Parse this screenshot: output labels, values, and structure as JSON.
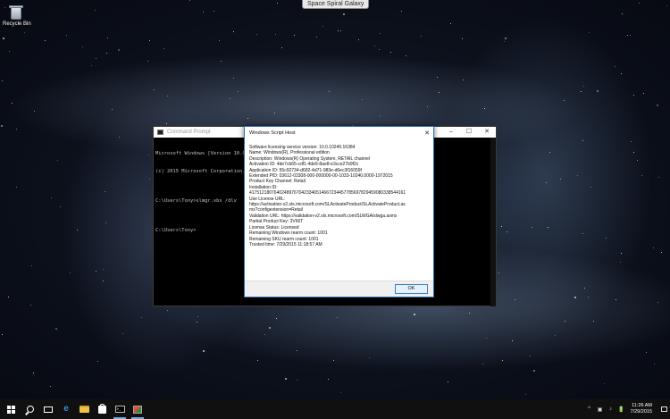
{
  "desktop": {
    "tooltip": "Space Spiral Galaxy",
    "recycle_bin_label": "Recycle Bin"
  },
  "cmd_window": {
    "title": "Command Prompt",
    "lines": [
      "Microsoft Windows [Version 10.0.",
      "(c) 2015 Microsoft Corporation.",
      "",
      "C:\\Users\\Tony>slmgr.vbs /dlv",
      "",
      "C:\\Users\\Tony>"
    ],
    "controls": {
      "minimize": "–",
      "maximize": "☐",
      "close": "✕"
    }
  },
  "wsh_dialog": {
    "title": "Windows Script Host",
    "close": "✕",
    "lines": [
      "Software licensing service version: 10.0.10240.16384",
      "",
      "Name: Windows(R), Professional edition",
      "Description: Windows(R) Operating System, RETAIL channel",
      "Activation ID: 4de7cb65-cdf1-4de9-8ae8-e3cce27b9f2c",
      "Application ID: 55c92734-d682-4d71-983e-d6ec3f16059f",
      "Extended PID: 03612-03308-000-000000-00-1033-10240.0000-1972015",
      "Product Key Channel: Retail",
      "Installation ID:",
      "417512180764024897670423346514667234457785697829459080338544161",
      "Use License URL:",
      "https://activation-v2.sls.microsoft.com/SLActivateProduct/SLActivateProduct.as",
      "mx?configextension=Retail",
      "Validation URL: https://validation-v2.sls.microsoft.com/SLWGA/slwga.asmx",
      "Partial Product Key: 3V66T",
      "License Status: Licensed",
      "Remaining Windows rearm count: 1001",
      "Remaining SKU rearm count: 1001",
      "Trusted time: 7/29/2015 11:18:57 AM"
    ],
    "ok_label": "OK"
  },
  "taskbar": {
    "clock_time": "11:26 AM",
    "clock_date": "7/29/2015",
    "tray_items": [
      "^",
      "▣",
      "♪",
      "🔋"
    ]
  }
}
